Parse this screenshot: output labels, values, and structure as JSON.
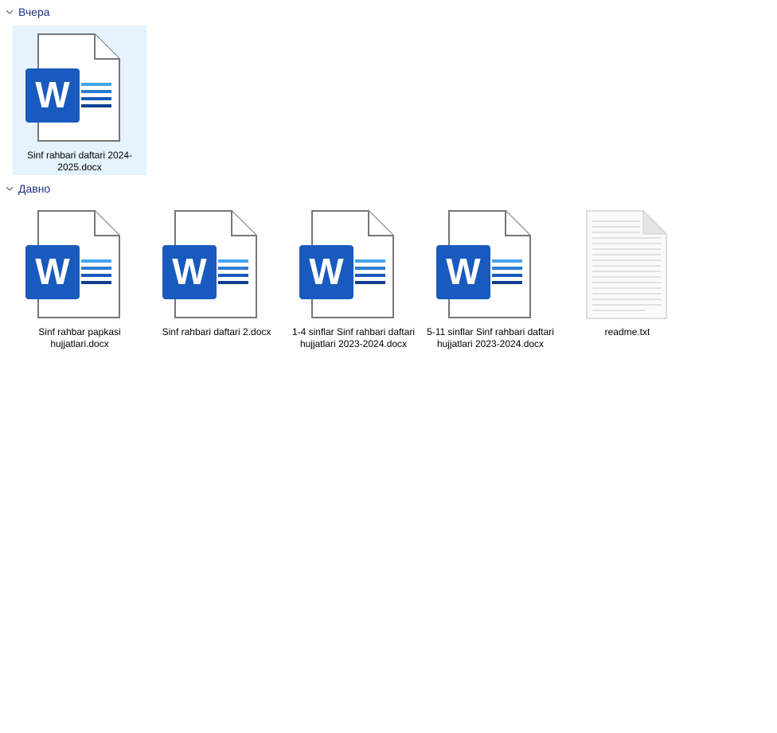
{
  "groups": [
    {
      "header": "Вчера",
      "files": [
        {
          "name": "Sinf rahbari daftari 2024-2025.docx",
          "icon": "word-document-icon",
          "selected": true
        }
      ]
    },
    {
      "header": "Давно",
      "files": [
        {
          "name": "Sinf rahbar papkasi hujjatlari.docx",
          "icon": "word-document-icon"
        },
        {
          "name": "Sinf rahbari daftari 2.docx",
          "icon": "word-document-icon"
        },
        {
          "name": "1-4 sinflar Sinf rahbari daftari hujjatlari 2023-2024.docx",
          "icon": "word-document-icon"
        },
        {
          "name": "5-11 sinflar Sinf rahbari daftari hujjatlari 2023-2024.docx",
          "icon": "word-document-icon"
        },
        {
          "name": "readme.txt",
          "icon": "text-document-icon"
        }
      ]
    }
  ],
  "colors": {
    "group_header": "#1e3287",
    "selection": "#e5f3ff",
    "word_blue": "#185abd"
  }
}
